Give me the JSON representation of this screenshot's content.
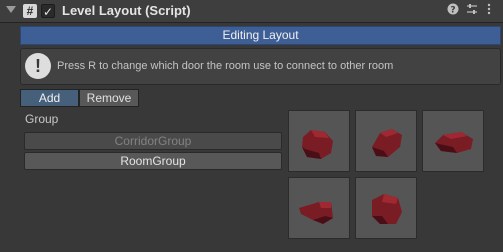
{
  "header": {
    "title": "Level Layout (Script)",
    "script_icon": "#",
    "enabled": "✓",
    "icons": [
      "help-icon",
      "preset-icon",
      "more-menu-icon"
    ]
  },
  "mode_bar": {
    "label": "Editing Layout"
  },
  "help": {
    "icon": "info-icon",
    "text": "Press R to change which door the room use to connect to other room"
  },
  "tabs": {
    "add": "Add",
    "remove": "Remove"
  },
  "groups": {
    "label": "Group",
    "items": [
      "CorridorGroup",
      "RoomGroup"
    ]
  },
  "thumbnails": {
    "count_shown": 5,
    "color": "#7a1c24"
  }
}
